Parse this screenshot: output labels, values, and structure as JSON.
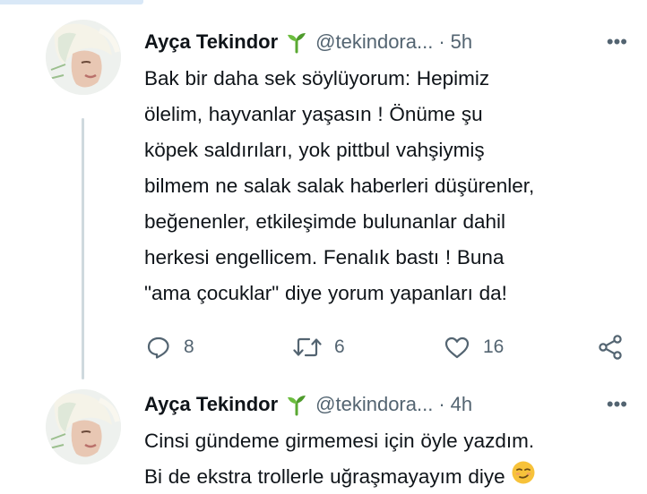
{
  "tweets": [
    {
      "author_name": "Ayça Tekindor",
      "author_handle": "@tekindora...",
      "dot": "·",
      "time": "5h",
      "more": "•••",
      "text": "Bak bir daha sek söylüyorum: Hepimiz\nölelim, hayvanlar yaşasın ! Önüme şu\nköpek saldırıları, yok pittbul vahşiymiş\nbilmem ne salak salak haberleri düşürenler,\nbeğenenler, etkileşimde bulunanlar dahil\nherkesi engellicem. Fenalık bastı ! Buna\n\"ama çocuklar\" diye yorum yapanları da!",
      "replies": "8",
      "retweets": "6",
      "likes": "16"
    },
    {
      "author_name": "Ayça Tekindor",
      "author_handle": "@tekindora...",
      "dot": "·",
      "time": "4h",
      "more": "•••",
      "text_line1": "Cinsi gündeme girmemesi için öyle yazdım.",
      "text_line2": "Bi de ekstra trollerle uğraşmayayım diye"
    }
  ],
  "icons": {
    "badge": "seedling-icon",
    "reply": "reply-icon",
    "retweet": "retweet-icon",
    "like": "heart-icon",
    "share": "share-icon",
    "emoji": "smirk-emoji"
  },
  "colors": {
    "text": "#0f1419",
    "secondary": "#536471",
    "badge_green": "#5aa832",
    "thread_line": "#cfd9de"
  }
}
